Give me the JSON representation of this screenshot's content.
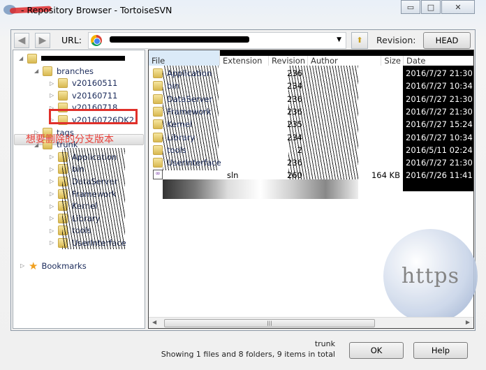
{
  "window": {
    "title": "- Repository Browser - TortoiseSVN",
    "minimize": "▭",
    "maximize": "□",
    "close": "✕"
  },
  "toolbar": {
    "back_icon": "arrow-left-icon",
    "forward_icon": "arrow-right-icon",
    "url_label": "URL:",
    "url_dropdown": "▼",
    "up_icon": "folder-up-icon",
    "revision_label": "Revision:",
    "revision_value": "HEAD"
  },
  "tree": {
    "items": [
      {
        "label": "branches",
        "level": 1,
        "arrow": "◢"
      },
      {
        "label": "v20160511",
        "level": 2,
        "arrow": "▷"
      },
      {
        "label": "v20160711",
        "level": 2,
        "arrow": "▷"
      },
      {
        "label": "v20160718",
        "level": 2,
        "arrow": "▷"
      },
      {
        "label": "v20160726DK2",
        "level": 2,
        "arrow": "▷"
      },
      {
        "label": "tags",
        "level": 1,
        "arrow": "▷"
      },
      {
        "label": "trunk",
        "level": 1,
        "arrow": "◢"
      },
      {
        "label": "Application",
        "level": 2,
        "arrow": "▷"
      },
      {
        "label": "bin",
        "level": 2,
        "arrow": "▷"
      },
      {
        "label": "DataServer",
        "level": 2,
        "arrow": "▷"
      },
      {
        "label": "Framework",
        "level": 2,
        "arrow": "▷"
      },
      {
        "label": "Kernel",
        "level": 2,
        "arrow": "▷"
      },
      {
        "label": "Library",
        "level": 2,
        "arrow": "▷"
      },
      {
        "label": "tools",
        "level": 2,
        "arrow": "▷"
      },
      {
        "label": "UserInterface",
        "level": 2,
        "arrow": "▷"
      }
    ],
    "bookmarks": "Bookmarks",
    "annotation": "想要删除的分支版本",
    "highlight_color": "#e0302a"
  },
  "list": {
    "columns": [
      "File",
      "Extension",
      "Revision",
      "Author",
      "Size",
      "Date"
    ],
    "rows": [
      {
        "file": "Application",
        "ext": "",
        "rev": "236",
        "size": "",
        "date": "2016/7/27 21:30"
      },
      {
        "file": "bin",
        "ext": "",
        "rev": "234",
        "size": "",
        "date": "2016/7/27 10:34"
      },
      {
        "file": "DataServer",
        "ext": "",
        "rev": "236",
        "size": "",
        "date": "2016/7/27 21:30"
      },
      {
        "file": "Framework",
        "ext": "",
        "rev": "236",
        "size": "",
        "date": "2016/7/27 21:30"
      },
      {
        "file": "Kernel",
        "ext": "",
        "rev": "235",
        "size": "",
        "date": "2016/7/27 15:24"
      },
      {
        "file": "Library",
        "ext": "",
        "rev": "234",
        "size": "",
        "date": "2016/7/27 10:34"
      },
      {
        "file": "tools",
        "ext": "",
        "rev": "2",
        "size": "",
        "date": "2016/5/11 02:24"
      },
      {
        "file": "UserInterface",
        "ext": "",
        "rev": "236",
        "size": "",
        "date": "2016/7/27 21:30"
      },
      {
        "file": "",
        "ext": "sln",
        "rev": "260",
        "size": "164 KB",
        "date": "2016/7/26 11:41"
      }
    ]
  },
  "status": {
    "path": "trunk",
    "summary": "Showing 1 files and 8 folders, 9 items in total"
  },
  "buttons": {
    "ok": "OK",
    "help": "Help"
  },
  "watermark": "https"
}
